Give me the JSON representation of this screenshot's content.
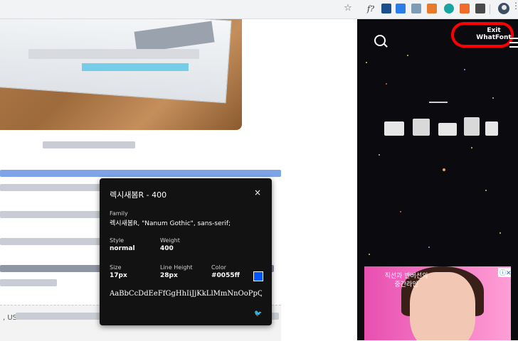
{
  "browser": {
    "toolbar_icons": [
      "star-icon",
      "whatfont-icon",
      "extension-icon",
      "extension-icon",
      "extension-icon",
      "extension-icon",
      "extension-icon",
      "extension-icon",
      "extension-icon",
      "profile-avatar",
      "menu-icon"
    ],
    "whatfont_glyph": "f?",
    "star_glyph": "☆"
  },
  "sidebar": {
    "exit_label": "Exit WhatFont",
    "ad": {
      "headline": "직선과 반버선의 중간라인",
      "info_glyph": "ⓘ✕"
    }
  },
  "whatfont": {
    "font_title": "렉시새봄R - 400",
    "close_glyph": "×",
    "family_label": "Family",
    "family_value": "렉시새봄R, \"Nanum Gothic\", sans-serif;",
    "style_label": "Style",
    "style_value": "normal",
    "weight_label": "Weight",
    "weight_value": "400",
    "size_label": "Size",
    "size_value": "17px",
    "line_height_label": "Line Height",
    "line_height_value": "28px",
    "color_label": "Color",
    "color_value": "#0055ff",
    "sample_text": "AaBbCcDdEeFfGgHhIiJjKkLlMmNnOoPpQqRrSsTt",
    "tweet_glyph": "🐦"
  },
  "content": {
    "bottom_text": ", US"
  },
  "colors": {
    "accent_blue": "#0055ff",
    "highlight_red": "#ff0000",
    "sidebar_bg": "#0b0b0f",
    "popup_bg": "#121212"
  }
}
